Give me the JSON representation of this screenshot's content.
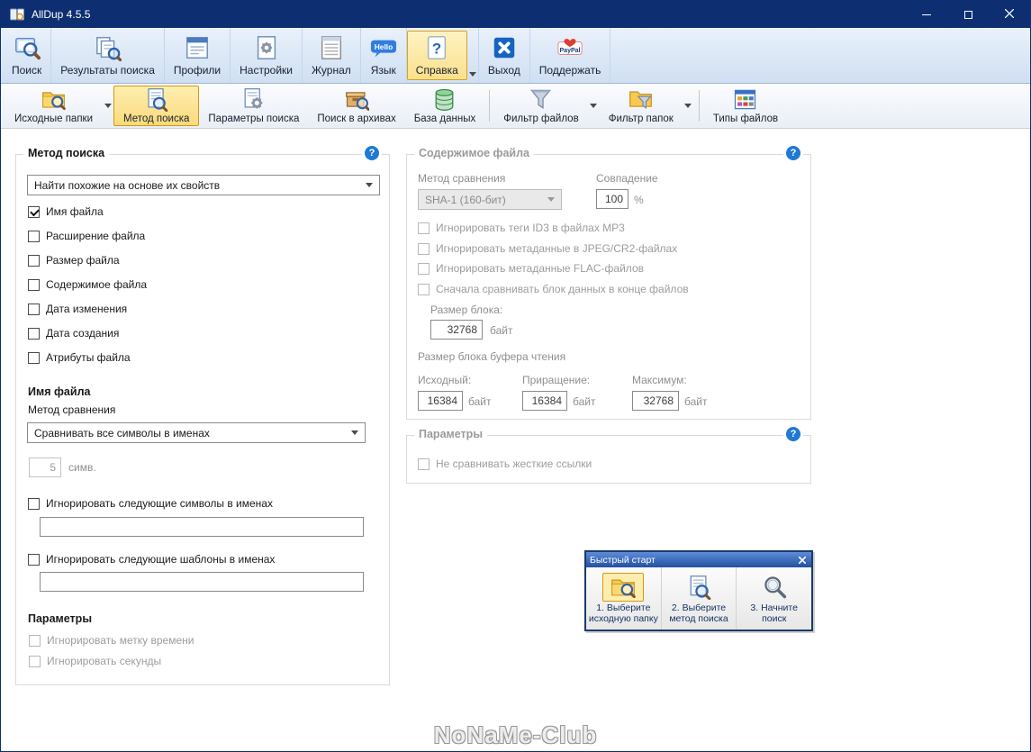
{
  "window": {
    "title": "AllDup 4.5.5",
    "logo_icon": "app"
  },
  "icons": {
    "help_glyph": "?",
    "language_badge": "Hello",
    "paypal_badge": "PayPal"
  },
  "toolbar_main": {
    "items": [
      {
        "label": "Поиск",
        "icon": "search"
      },
      {
        "label": "Результаты поиска",
        "icon": "results"
      },
      {
        "label": "Профили",
        "icon": "profiles"
      },
      {
        "label": "Настройки",
        "icon": "settings"
      },
      {
        "label": "Журнал",
        "icon": "journal"
      },
      {
        "label": "Язык",
        "icon": "language"
      },
      {
        "label": "Справка",
        "icon": "help",
        "active": true
      },
      {
        "label": "Выход",
        "icon": "exit"
      },
      {
        "label": "Поддержать",
        "icon": "paypal"
      }
    ]
  },
  "toolbar_sub": {
    "items": [
      {
        "label": "Исходные папки",
        "icon": "source-folders",
        "dropdown": true
      },
      {
        "label": "Метод поиска",
        "icon": "search-method",
        "active": true
      },
      {
        "label": "Параметры поиска",
        "icon": "search-options"
      },
      {
        "label": "Поиск в архивах",
        "icon": "archive-search"
      },
      {
        "label": "База данных",
        "icon": "database"
      },
      {
        "label": "Фильтр файлов",
        "icon": "file-filter",
        "dropdown": true
      },
      {
        "label": "Фильтр папок",
        "icon": "folder-filter",
        "dropdown": true
      },
      {
        "label": "Типы файлов",
        "icon": "file-types"
      }
    ]
  },
  "search_method_box": {
    "title": "Метод поиска",
    "method_select": "Найти похожие на основе их свойств",
    "criteria": [
      {
        "label": "Имя файла",
        "checked": true
      },
      {
        "label": "Расширение файла",
        "checked": false
      },
      {
        "label": "Размер файла",
        "checked": false
      },
      {
        "label": "Содержимое файла",
        "checked": false
      },
      {
        "label": "Дата изменения",
        "checked": false
      },
      {
        "label": "Дата создания",
        "checked": false
      },
      {
        "label": "Атрибуты файла",
        "checked": false
      }
    ],
    "filename": {
      "title": "Имя файла",
      "compare_label": "Метод сравнения",
      "compare_select": "Сравнивать все символы в именах",
      "chars_value": "5",
      "chars_unit": "симв.",
      "ignore_chars_label": "Игнорировать следующие символы в именах",
      "ignore_chars_value": "",
      "ignore_patterns_label": "Игнорировать следующие шаблоны в именах",
      "ignore_patterns_value": ""
    },
    "params": {
      "title": "Параметры",
      "ignore_timestamp": "Игнорировать метку времени",
      "ignore_seconds": "Игнорировать секунды"
    }
  },
  "file_content_box": {
    "title": "Содержимое файла",
    "compare_label": "Метод сравнения",
    "compare_select": "SHA-1 (160-бит)",
    "match_label": "Совпадение",
    "match_value": "100",
    "match_unit": "%",
    "options": [
      "Игнорировать теги ID3 в файлах MP3",
      "Игнорировать метаданные в JPEG/CR2-файлах",
      "Игнорировать метаданные FLAC-файлов",
      "Сначала сравнивать блок данных в конце файлов"
    ],
    "block_size_label": "Размер блока:",
    "block_size_value": "32768",
    "unit_bytes": "байт",
    "buffer_title": "Размер блока буфера чтения",
    "buffer": [
      {
        "label": "Исходный:",
        "value": "16384"
      },
      {
        "label": "Приращение:",
        "value": "16384"
      },
      {
        "label": "Максимум:",
        "value": "32768"
      }
    ]
  },
  "parameters_box": {
    "title": "Параметры",
    "option": "Не сравнивать жесткие ссылки"
  },
  "quick_start": {
    "title": "Быстрый старт",
    "steps": [
      {
        "label": "1. Выберите исходную папку",
        "icon": "source-folders",
        "active": true
      },
      {
        "label": "2. Выберите метод поиска",
        "icon": "search-method",
        "active": false
      },
      {
        "label": "3. Начните поиск",
        "icon": "magnifier",
        "active": false
      }
    ]
  },
  "watermark": "NoNaMe-Club"
}
